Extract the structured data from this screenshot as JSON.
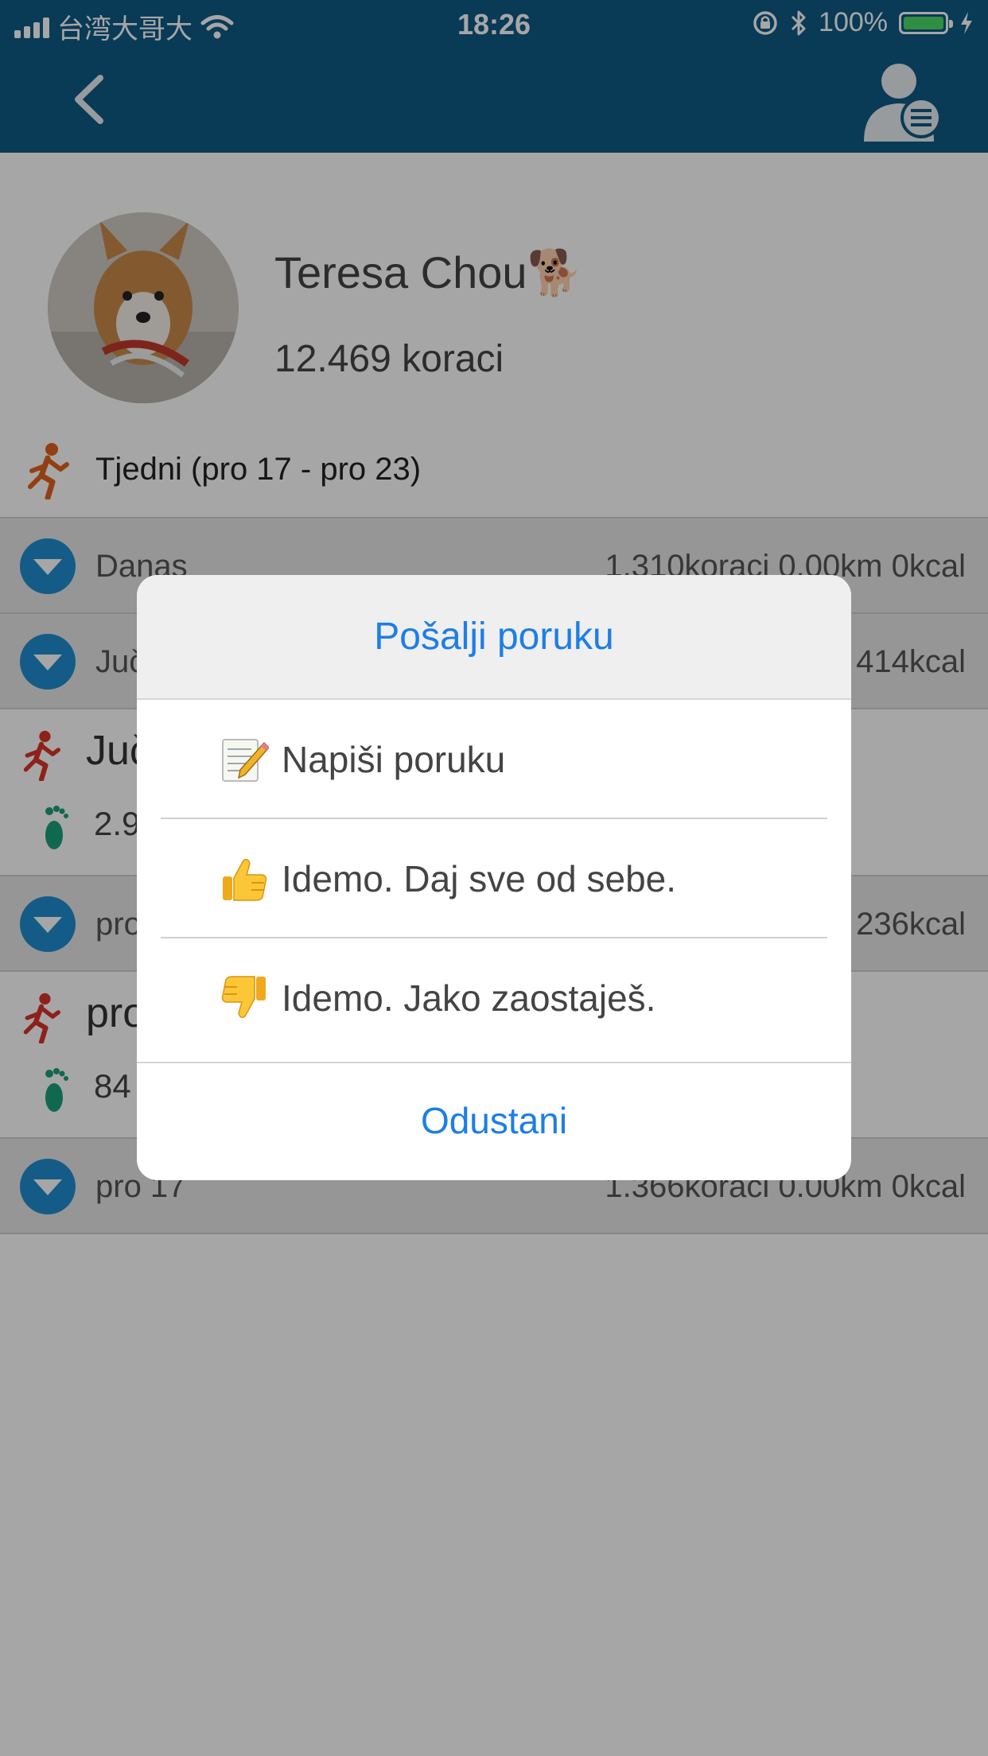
{
  "status_bar": {
    "carrier": "台湾大哥大",
    "time": "18:26",
    "battery_pct": "100%",
    "battery_level": 1.0
  },
  "colors": {
    "navbar": "#0f5a85",
    "accent_blue": "#1f8ed0",
    "action_text": "#1d7ee6",
    "runner": "#e0621e",
    "foot": "#1aa07a",
    "battery_green": "#4cd964"
  },
  "navbar": {
    "back_icon": "chevron-left-icon",
    "menu_icon": "user-menu-icon"
  },
  "profile": {
    "name": "Teresa Chou🐕",
    "steps": "12.469 koraci"
  },
  "week": {
    "label": "Tjedni (pro 17 - pro 23)"
  },
  "rows": [
    {
      "date": "Danas",
      "stats": "1.310koraci 0.00km 0kcal"
    },
    {
      "date": "Jučer",
      "stats": "414kcal"
    },
    {
      "date": "pro 19",
      "stats": "236kcal"
    },
    {
      "date": "pro 17",
      "stats": "1.366koraci 0.00km 0kcal"
    }
  ],
  "details": [
    {
      "label": "Jučer",
      "value": "2.9"
    },
    {
      "label": "pro",
      "value": "84"
    }
  ],
  "sheet": {
    "title": "Pošalji poruku",
    "options": [
      {
        "icon": "memo-pencil-icon",
        "label": "Napiši poruku"
      },
      {
        "icon": "thumbs-up-icon",
        "label": "Idemo. Daj sve od sebe."
      },
      {
        "icon": "thumbs-down-icon",
        "label": "Idemo. Jako zaostaješ."
      }
    ],
    "cancel": "Odustani"
  }
}
